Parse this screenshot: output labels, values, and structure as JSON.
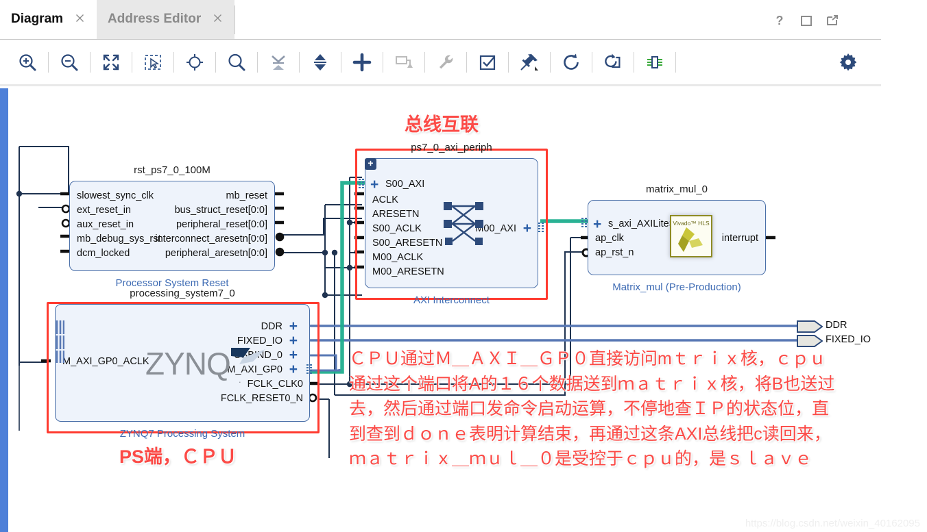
{
  "window": {
    "tabs": [
      {
        "label": "Diagram",
        "active": true,
        "close_icon": "close-icon"
      },
      {
        "label": "Address Editor",
        "active": false,
        "close_icon": "close-icon"
      }
    ],
    "controls": [
      {
        "name": "help-icon",
        "glyph": "?"
      },
      {
        "name": "maximize-icon",
        "glyph": "□"
      },
      {
        "name": "float-window-icon",
        "glyph": "↗"
      }
    ]
  },
  "toolbar": {
    "items": [
      {
        "name": "zoom-in-icon",
        "tip": "Zoom In"
      },
      {
        "name": "zoom-out-icon",
        "tip": "Zoom Out"
      },
      {
        "name": "zoom-fit-icon",
        "tip": "Zoom Fit"
      },
      {
        "name": "select-area-icon",
        "tip": "Select Area"
      },
      {
        "name": "zoom-to-selection-icon",
        "tip": "Fit Selection"
      },
      {
        "name": "search-icon",
        "tip": "Search"
      },
      {
        "name": "collapse-all-icon",
        "tip": "Collapse All"
      },
      {
        "name": "expand-all-icon",
        "tip": "Expand All"
      },
      {
        "name": "add-ip-icon",
        "tip": "Add IP"
      },
      {
        "name": "add-module-icon",
        "tip": "Add Module"
      },
      {
        "name": "settings-wrench-icon",
        "tip": "Customize Block"
      },
      {
        "name": "validate-design-icon",
        "tip": "Validate Design"
      },
      {
        "name": "pin-icon",
        "tip": "Pin"
      },
      {
        "name": "refresh-icon",
        "tip": "Refresh"
      },
      {
        "name": "run-connection-automation-icon",
        "tip": "Run Connection Automation"
      },
      {
        "name": "run-block-automation-icon",
        "tip": "Run Block Automation"
      }
    ],
    "gear": {
      "name": "gear-icon",
      "tip": "Settings"
    }
  },
  "diagram": {
    "blocks": [
      {
        "id": "rst",
        "title": "rst_ps7_0_100M",
        "subtitle": "Processor System Reset",
        "inputs": [
          "slowest_sync_clk",
          "ext_reset_in",
          "aux_reset_in",
          "mb_debug_sys_rst",
          "dcm_locked"
        ],
        "outputs": [
          "mb_reset",
          "bus_struct_reset[0:0]",
          "peripheral_reset[0:0]",
          "interconnect_aresetn[0:0]",
          "peripheral_aresetn[0:0]"
        ]
      },
      {
        "id": "interconnect",
        "title": "ps7_0_axi_periph",
        "subtitle": "AXI Interconnect",
        "inputs": [
          "S00_AXI",
          "ACLK",
          "ARESETN",
          "S00_ACLK",
          "S00_ARESETN",
          "M00_ACLK",
          "M00_ARESETN"
        ],
        "outputs": [
          "M00_AXI"
        ],
        "highlighted": true
      },
      {
        "id": "matrix",
        "title": "matrix_mul_0",
        "subtitle": "Matrix_mul (Pre-Production)",
        "inputs": [
          "s_axi_AXILiteS",
          "ap_clk",
          "ap_rst_n"
        ],
        "outputs": [
          "interrupt"
        ],
        "logo_text": "Vivado™ HLS"
      },
      {
        "id": "zynq",
        "title": "processing_system7_0",
        "subtitle": "ZYNQ7 Processing System",
        "inputs": [
          "M_AXI_GP0_ACLK"
        ],
        "outputs": [
          "DDR",
          "FIXED_IO",
          "USBIND_0",
          "M_AXI_GP0",
          "FCLK_CLK0",
          "FCLK_RESET0_N"
        ],
        "logo_text": "ZYNQ",
        "highlighted": true
      }
    ],
    "external_ports": [
      {
        "label": "DDR"
      },
      {
        "label": "FIXED_IO"
      }
    ]
  },
  "annotations": {
    "bus_title": "总线互联",
    "ps_title": "PS端，ＣＰＵ",
    "body_lines": [
      "ＣＰＵ通过Ｍ＿ＡＸＩ＿ＧＰ０直接访问mｔｒｉｘ核，ｃｐｕ",
      "通过这个端口将A的１６个数据送到ｍａｔｒｉｘ核，将B也送过",
      "去，然后通过端口发命令启动运算，不停地查ＩＰ的状态位，直",
      "到查到ｄｏｎｅ表明计算结束，再通过这条AXI总线把c读回来，",
      "ｍａｔｒｉｘ＿ｍｕｌ＿０是受控于ｃｐｕ的，是ｓｌａｖｅ"
    ]
  },
  "watermark": "https://blog.csdn.net/weixin_40162095"
}
